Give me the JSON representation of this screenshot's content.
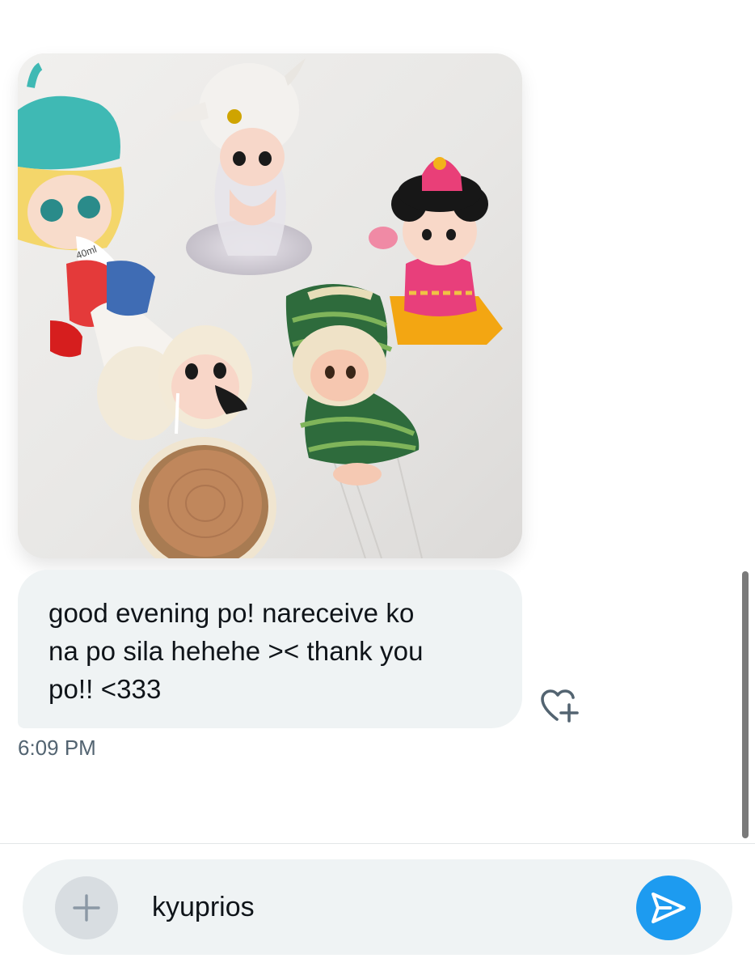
{
  "message": {
    "text": "good evening po! nareceive ko na po sila hehehe >< thank you po!! <333",
    "lines": [
      "good evening po! nareceive ko",
      "na po sila hehehe >< thank you",
      "po!! <333"
    ],
    "timestamp": "6:09 PM",
    "react_icon": "heart-plus-icon",
    "photo_figure_labels": {
      "cup_label": "40ml"
    }
  },
  "composer": {
    "add_icon": "plus-icon",
    "input_value": "kyuprios",
    "send_icon": "send-arrow-icon"
  },
  "colors": {
    "accent": "#1d9bf0",
    "bubble_background": "#eff3f4",
    "text_primary": "#0f1419",
    "text_secondary": "#536471"
  }
}
